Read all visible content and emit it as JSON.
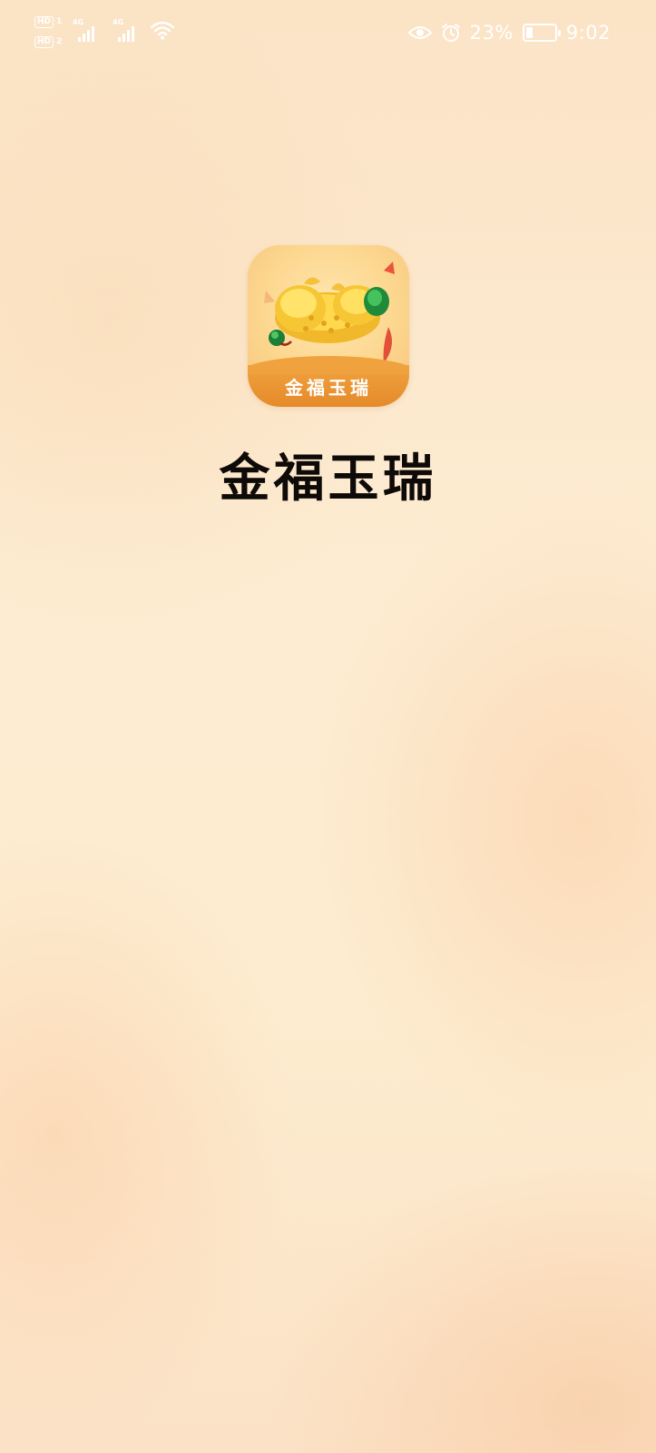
{
  "status_bar": {
    "sim1_label": "HD",
    "sim1_num": "1",
    "sim2_label": "HD",
    "sim2_num": "2",
    "network1": "4G",
    "network2": "4G",
    "battery_percent": "23%",
    "battery_level": 0.23,
    "time": "9:02",
    "icons": [
      "signal-icon",
      "wifi-icon",
      "eye-icon",
      "alarm-icon",
      "battery-icon"
    ]
  },
  "splash": {
    "icon_label": "金福玉瑞",
    "app_name": "金福玉瑞"
  },
  "colors": {
    "background": "#fdecd2",
    "banner": "#e58a2a",
    "title_text": "#0d0a08"
  }
}
